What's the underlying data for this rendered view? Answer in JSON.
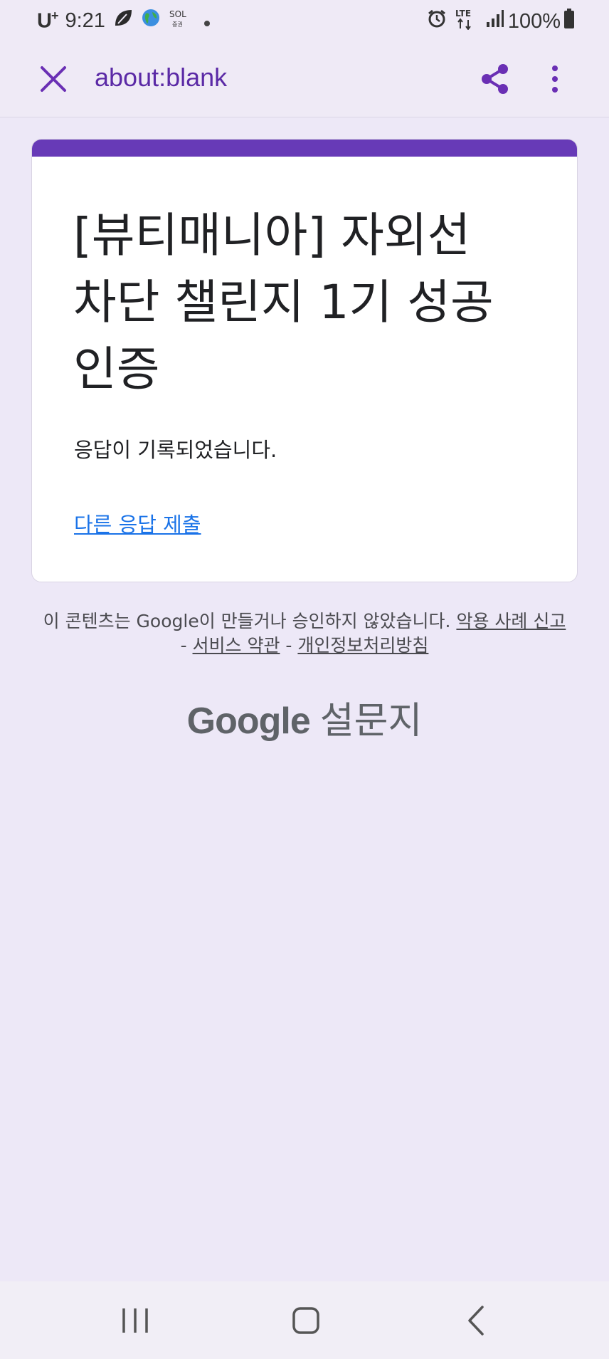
{
  "status_bar": {
    "carrier": "U",
    "carrier_sup": "+",
    "time": "9:21",
    "notification_icons": [
      "leaf-icon",
      "globe-icon",
      "sol-app-icon",
      "dot-icon"
    ],
    "sol_icon_text": "SOL",
    "sol_icon_sub": "증권",
    "right_icons": [
      "alarm-icon",
      "lte-icon",
      "signal-icon",
      "battery-icon"
    ],
    "lte_label": "LTE",
    "battery_percent": "100%"
  },
  "toolbar": {
    "url": "about:blank",
    "close_icon": "close-icon",
    "share_icon": "share-icon",
    "menu_icon": "more-vert-icon",
    "accent_color": "#6a2fb4"
  },
  "card": {
    "accent_color": "#673ab7",
    "title_lines": [
      "[뷰티매니아] 자외선",
      "차단 챌린지 1기 성공",
      "인증"
    ],
    "message": "응답이 기록되었습니다.",
    "submit_another_link": "다른 응답 제출"
  },
  "footer": {
    "disclaimer_text": "이 콘텐츠는 Google이 만들거나 승인하지 않았습니다.",
    "abuse_link": "악용 사례 신고",
    "separator": " - ",
    "terms_link": "서비스 약관",
    "privacy_link": "개인정보처리방침"
  },
  "brand": {
    "google": "Google",
    "product": "설문지"
  },
  "nav_bar": {
    "buttons": [
      "recent-apps-icon",
      "home-icon",
      "back-icon"
    ]
  }
}
